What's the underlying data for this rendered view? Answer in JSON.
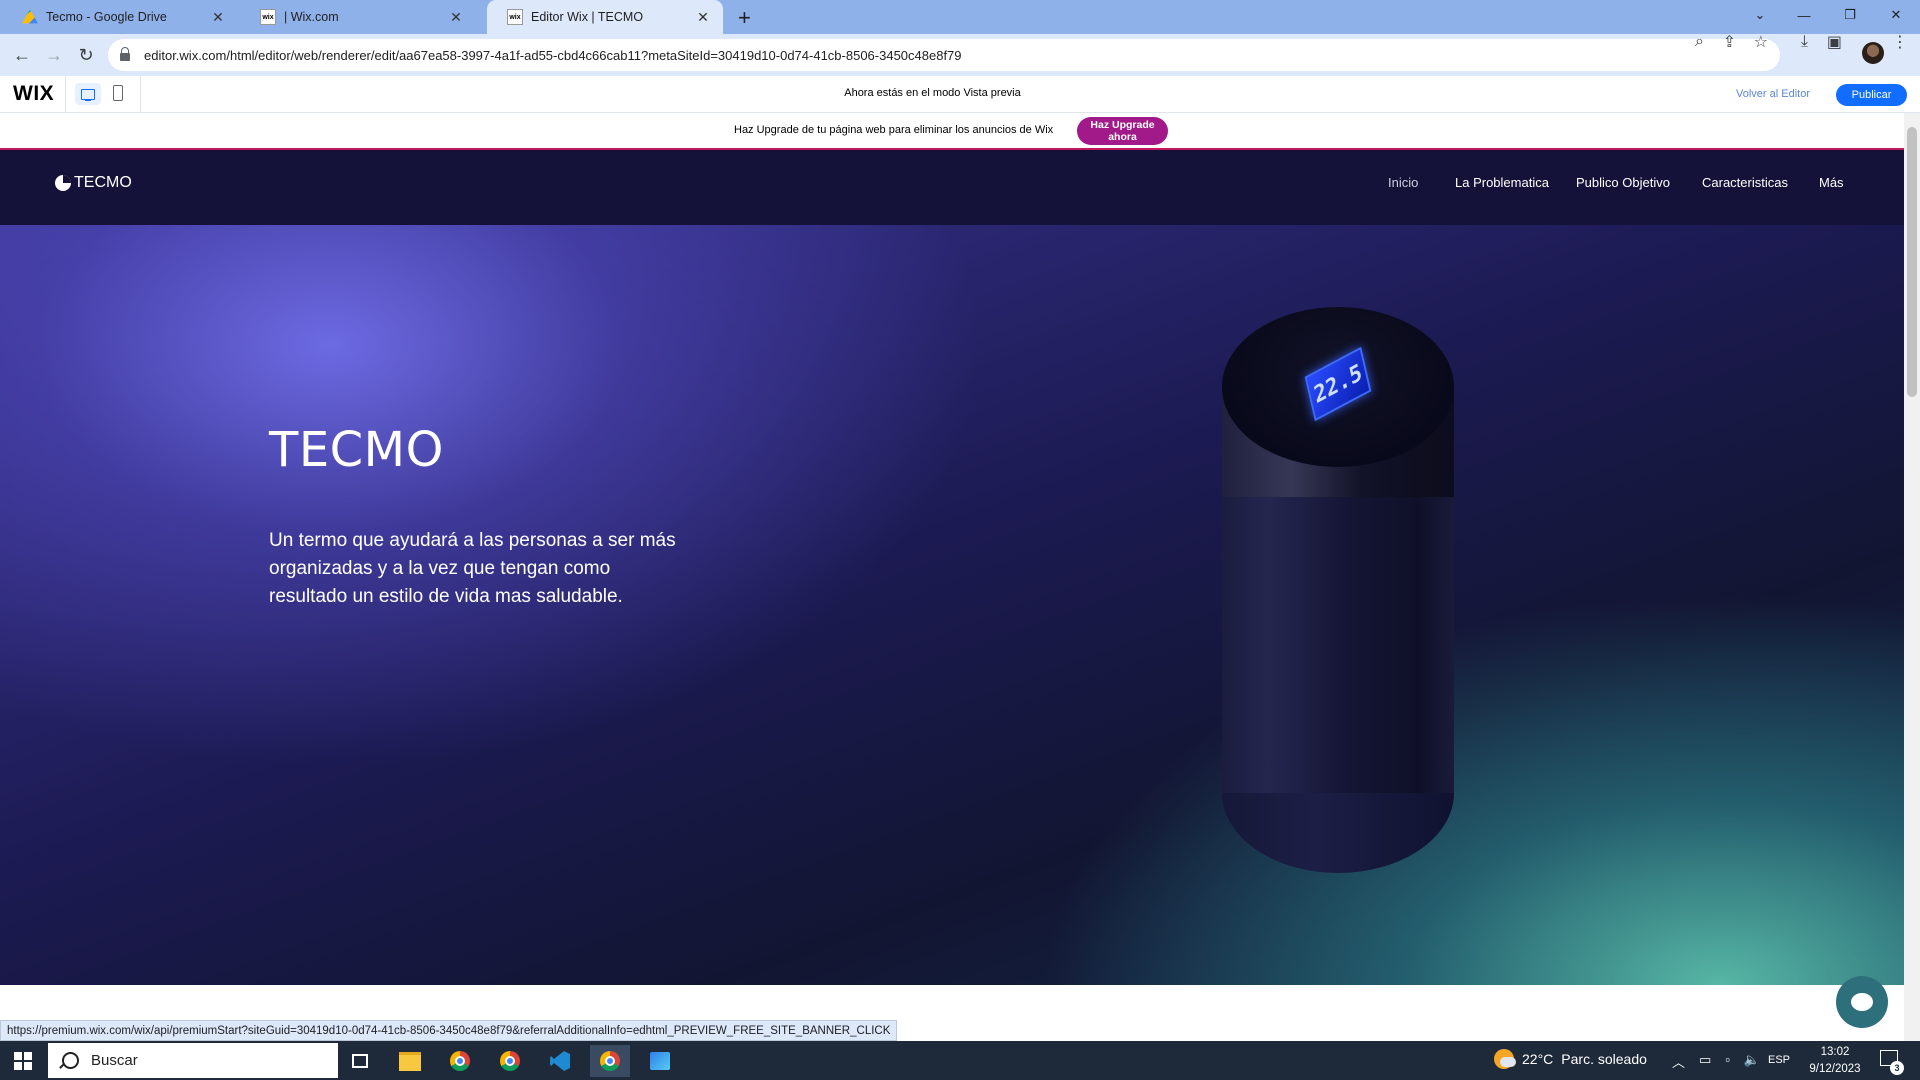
{
  "browser": {
    "tabs": [
      {
        "title": "Tecmo - Google Drive",
        "icon": "google-drive-icon",
        "active": false
      },
      {
        "title": "| Wix.com",
        "icon": "wix-icon",
        "active": false
      },
      {
        "title": "Editor Wix | TECMO",
        "icon": "wix-icon",
        "active": true
      }
    ],
    "close_glyph": "✕",
    "new_tab_glyph": "+",
    "url": "editor.wix.com/html/editor/web/renderer/edit/aa67ea58-3997-4a1f-ad55-cbd4c66cab11?metaSiteId=30419d10-0d74-41cb-8506-3450c48e8f79"
  },
  "wix_bar": {
    "logo": "WIX",
    "preview_message": "Ahora estás en el modo Vista previa",
    "back_to_editor": "Volver al Editor",
    "publish": "Publicar",
    "accent_color": "#116dff"
  },
  "upgrade_banner": {
    "text": "Haz Upgrade de tu página web para eliminar los anuncios de Wix",
    "button": "Haz Upgrade ahora",
    "button_color": "#a21a8a"
  },
  "site": {
    "brand": "TECMO",
    "nav": [
      "Inicio",
      "La Problematica",
      "Publico Objetivo",
      "Caracteristicas",
      "Más"
    ],
    "hero_title": "TECMO",
    "hero_text": "Un termo que ayudará a las personas a ser más organizadas y a la vez que tengan como resultado un estilo de vida mas saludable.",
    "thermos_display": "22.5"
  },
  "status_url": "https://premium.wix.com/wix/api/premiumStart?siteGuid=30419d10-0d74-41cb-8506-3450c48e8f79&referralAdditionalInfo=edhtml_PREVIEW_FREE_SITE_BANNER_CLICK",
  "taskbar": {
    "search_placeholder": "Buscar",
    "weather_temp": "22°C",
    "weather_desc": "Parc. soleado",
    "language": "ESP",
    "time": "13:02",
    "date": "9/12/2023",
    "notification_count": "3"
  }
}
